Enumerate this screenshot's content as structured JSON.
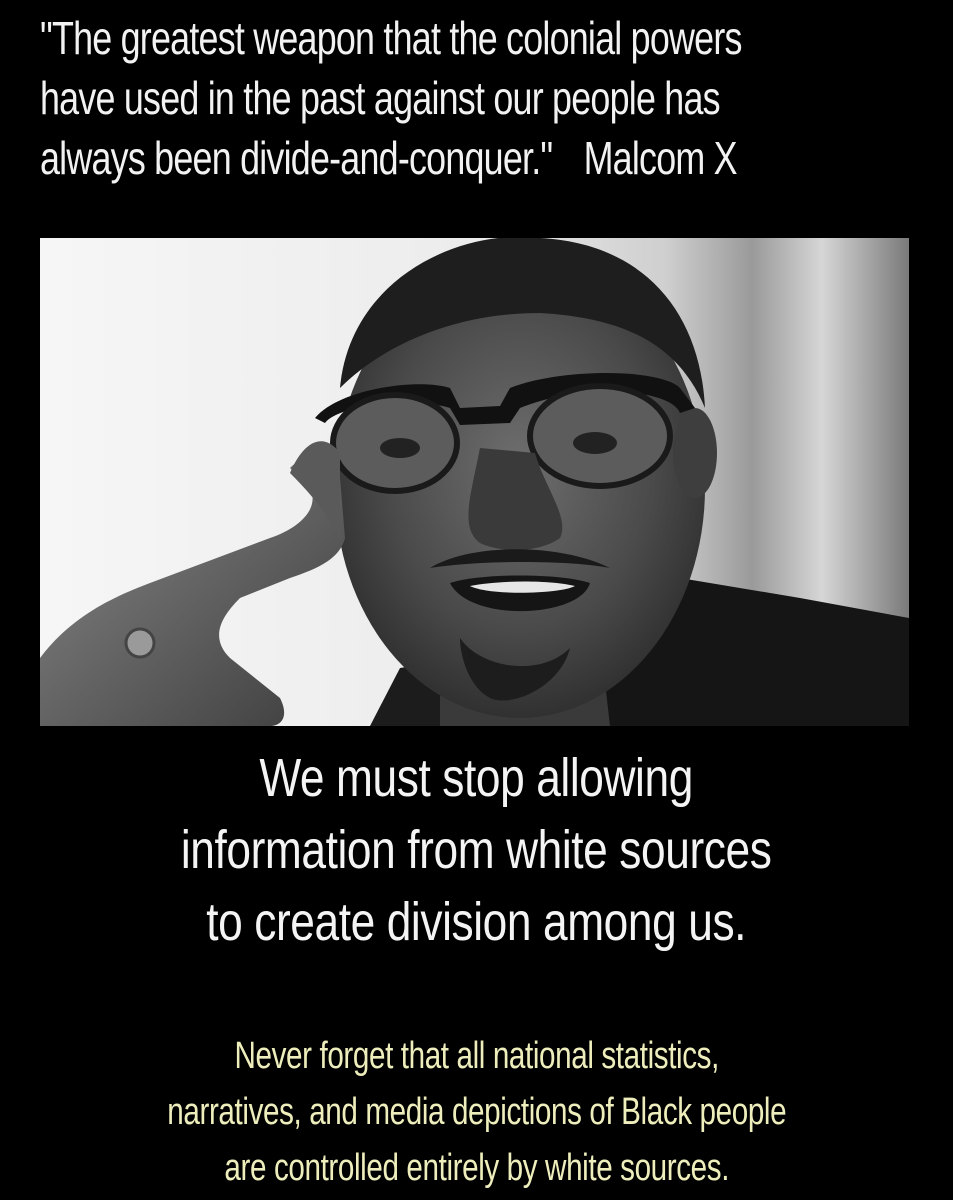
{
  "quote": {
    "lines": [
      "\"The greatest weapon that the colonial powers",
      "have used in the past against our people has",
      "always been divide-and-conquer.\""
    ],
    "attribution": "Malcom X"
  },
  "photo": {
    "subject": "man-with-glasses-hand-to-temple-portrait"
  },
  "headline": {
    "lines": [
      "We must stop allowing",
      "information from white sources",
      "to create division among us."
    ]
  },
  "subtext": {
    "lines": [
      "Never forget that all national statistics,",
      "narratives, and media depictions of Black people",
      "are controlled entirely by white sources."
    ],
    "color": "#eeeebc"
  },
  "colors": {
    "background": "#000000",
    "text": "#f2f2f2"
  }
}
